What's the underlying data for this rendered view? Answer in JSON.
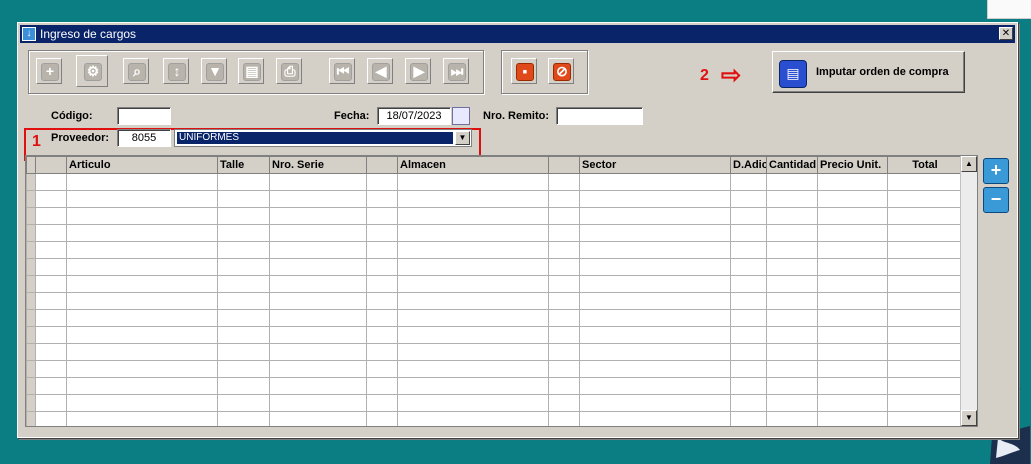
{
  "window": {
    "title": "Ingreso de cargos",
    "close_glyph": "✕"
  },
  "toolbar": {
    "buttons": [
      {
        "icon": "add-icon",
        "glyph": "+"
      },
      {
        "icon": "tools-icon",
        "glyph": "⚙"
      },
      {
        "icon": "search-icon",
        "glyph": "⌕"
      },
      {
        "icon": "sort-icon",
        "glyph": "↕"
      },
      {
        "icon": "filter-icon",
        "glyph": "▼"
      },
      {
        "icon": "clipboard-icon",
        "glyph": "▤"
      },
      {
        "icon": "print-icon",
        "glyph": "⎙"
      },
      {
        "icon": "first-icon",
        "glyph": "⏮"
      },
      {
        "icon": "prev-icon",
        "glyph": "◀"
      },
      {
        "icon": "next-icon",
        "glyph": "▶"
      },
      {
        "icon": "last-icon",
        "glyph": "⏭"
      }
    ],
    "save": {
      "icon": "save-icon",
      "glyph": "▪"
    },
    "cancel": {
      "icon": "cancel-icon",
      "glyph": "⊘"
    }
  },
  "form": {
    "codigo_label": "Código:",
    "codigo_value": "",
    "fecha_label": "Fecha:",
    "fecha_value": "18/07/2023",
    "remito_label": "Nro. Remito:",
    "remito_value": "",
    "proveedor_label": "Proveedor:",
    "proveedor_code": "8055",
    "proveedor_name": "UNIFORMES"
  },
  "imputar_button": {
    "label": "Imputar orden de compra"
  },
  "annotations": {
    "one": "1",
    "two": "2",
    "arrow": "⇨"
  },
  "grid": {
    "columns": [
      "",
      "Articulo",
      "Talle",
      "Nro. Serie",
      "",
      "Almacen",
      "",
      "Sector",
      "D.Adic",
      "Cantidad",
      "Precio Unit.",
      "Total"
    ],
    "row_count": 15
  },
  "side": {
    "add_glyph": "+",
    "remove_glyph": "−"
  },
  "colors": {
    "accent": "#0a246a",
    "annotation": "#e01010",
    "desktop": "#0a7e83"
  }
}
